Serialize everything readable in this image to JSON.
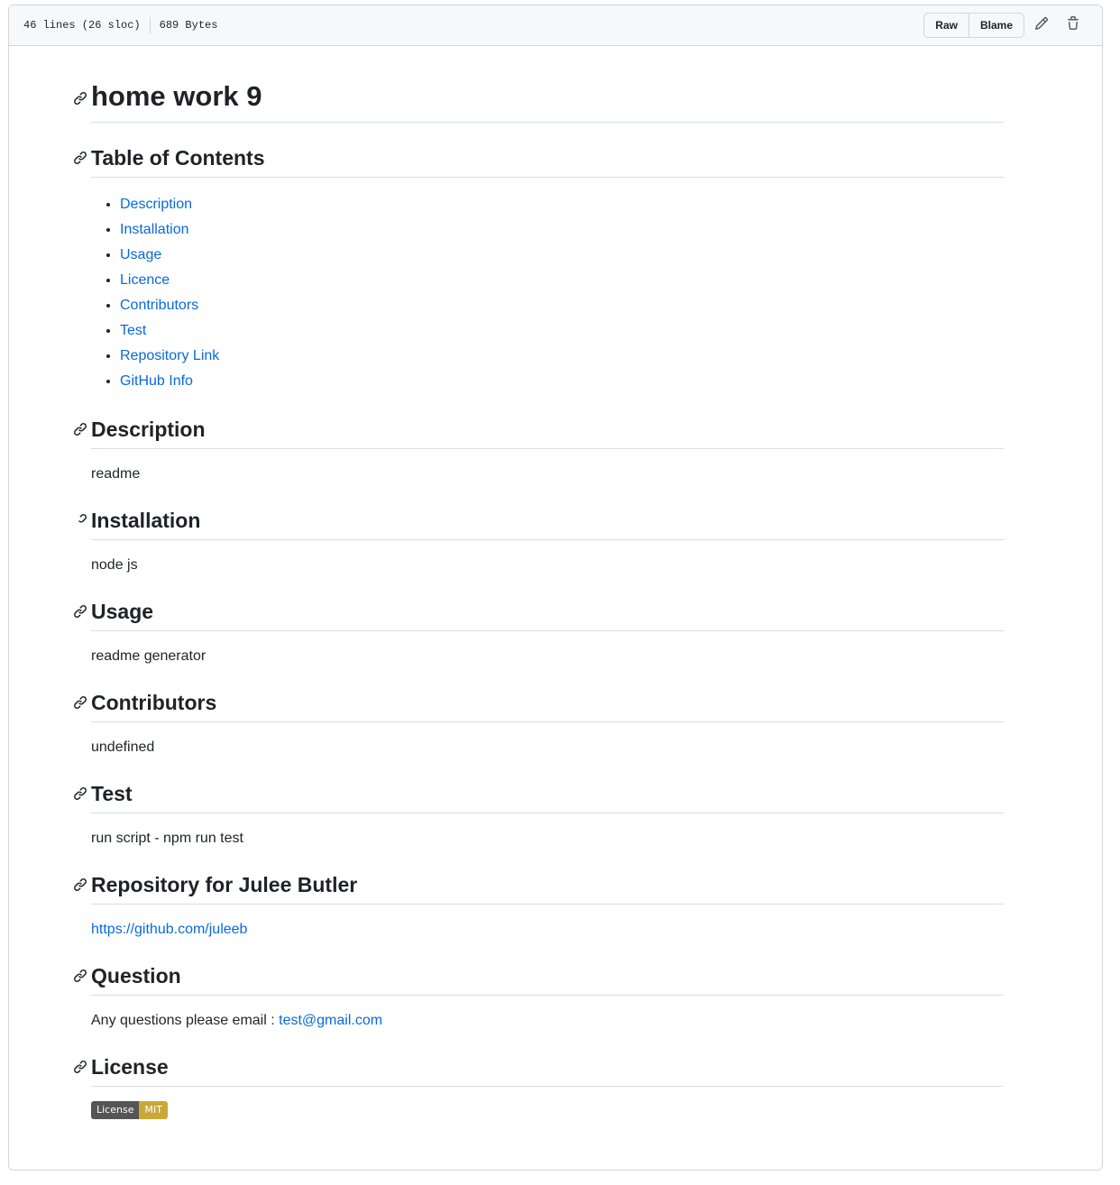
{
  "file_header": {
    "lines": "46 lines (26 sloc)",
    "size": "689 Bytes",
    "raw_label": "Raw",
    "blame_label": "Blame",
    "edit_icon": "pencil-icon",
    "delete_icon": "trash-icon"
  },
  "readme": {
    "title": "home work 9",
    "toc_heading": "Table of Contents",
    "toc_items": [
      "Description",
      "Installation",
      "Usage",
      "Licence",
      "Contributors",
      "Test",
      "Repository Link",
      "GitHub Info"
    ],
    "sections": {
      "description": {
        "heading": "Description",
        "text": "readme"
      },
      "installation": {
        "heading": "Installation",
        "text": "node js"
      },
      "usage": {
        "heading": "Usage",
        "text": "readme generator"
      },
      "contributors": {
        "heading": "Contributors",
        "text": "undefined"
      },
      "test": {
        "heading": "Test",
        "text": "run script - npm run test"
      },
      "repository": {
        "heading": "Repository for Julee Butler",
        "link": "https://github.com/juleeb"
      },
      "question": {
        "heading": "Question",
        "text": "Any questions please email : ",
        "email": "test@gmail.com"
      },
      "license": {
        "heading": "License",
        "badge_left": "License",
        "badge_right": "MIT"
      }
    }
  },
  "colors": {
    "link": "#0969da",
    "badge_left": "#555555",
    "badge_right": "#c9a834"
  }
}
